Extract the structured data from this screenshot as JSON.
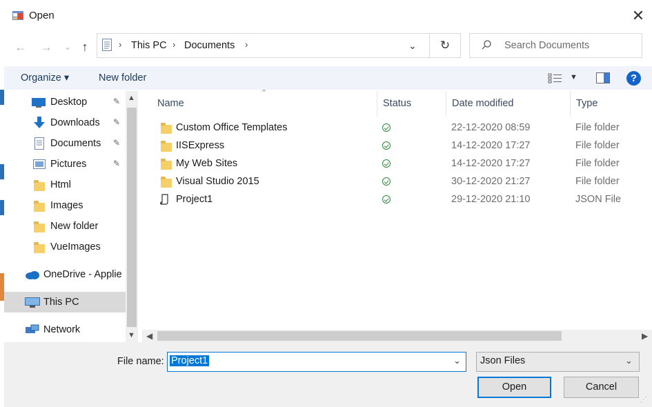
{
  "window": {
    "title": "Open",
    "close_glyph": "✕"
  },
  "nav_buttons": {
    "back": "←",
    "forward": "→",
    "recent": "⌄",
    "up": "↑"
  },
  "address": {
    "crumbs": [
      "This PC",
      "Documents"
    ],
    "sep": "›",
    "dropdown": "⌄",
    "refresh_glyph": "↻"
  },
  "search": {
    "placeholder": "Search Documents"
  },
  "toolbar": {
    "organize": "Organize ▾",
    "new_folder": "New folder",
    "help": "?"
  },
  "nav_pane": {
    "items": [
      {
        "label": "Desktop",
        "icon": "desktop-icon",
        "pinned": true
      },
      {
        "label": "Downloads",
        "icon": "downloads-icon",
        "pinned": true
      },
      {
        "label": "Documents",
        "icon": "documents-icon",
        "pinned": true
      },
      {
        "label": "Pictures",
        "icon": "pictures-icon",
        "pinned": true
      },
      {
        "label": "Html",
        "icon": "folder-icon",
        "pinned": false
      },
      {
        "label": "Images",
        "icon": "folder-icon",
        "pinned": false
      },
      {
        "label": "New folder",
        "icon": "folder-icon",
        "pinned": false
      },
      {
        "label": "VueImages",
        "icon": "folder-icon",
        "pinned": false
      },
      {
        "label": "OneDrive - Applie",
        "icon": "onedrive-icon",
        "pinned": false
      },
      {
        "label": "This PC",
        "icon": "this-pc-icon",
        "pinned": false,
        "selected": true
      },
      {
        "label": "Network",
        "icon": "network-icon",
        "pinned": false
      }
    ],
    "pin_glyph": "📌"
  },
  "columns": {
    "name": "Name",
    "status": "Status",
    "date": "Date modified",
    "type": "Type"
  },
  "files": [
    {
      "name": "Custom Office Templates",
      "icon": "folder-icon",
      "date": "22-12-2020 08:59",
      "type": "File folder"
    },
    {
      "name": "IISExpress",
      "icon": "folder-icon",
      "date": "14-12-2020 17:27",
      "type": "File folder"
    },
    {
      "name": "My Web Sites",
      "icon": "folder-icon",
      "date": "14-12-2020 17:27",
      "type": "File folder"
    },
    {
      "name": "Visual Studio 2015",
      "icon": "folder-icon",
      "date": "30-12-2020 21:27",
      "type": "File folder"
    },
    {
      "name": "Project1",
      "icon": "json-file-icon",
      "date": "29-12-2020 21:10",
      "type": "JSON File"
    }
  ],
  "bottom": {
    "file_name_label": "File name:",
    "file_name_value": "Project1",
    "file_type": "Json Files",
    "open_button": "Open",
    "cancel_button": "Cancel"
  },
  "colors": {
    "accent": "#0078d7",
    "help_blue": "#1364c8",
    "folder": "#f5cf68",
    "status_green": "#2a8a3a"
  }
}
